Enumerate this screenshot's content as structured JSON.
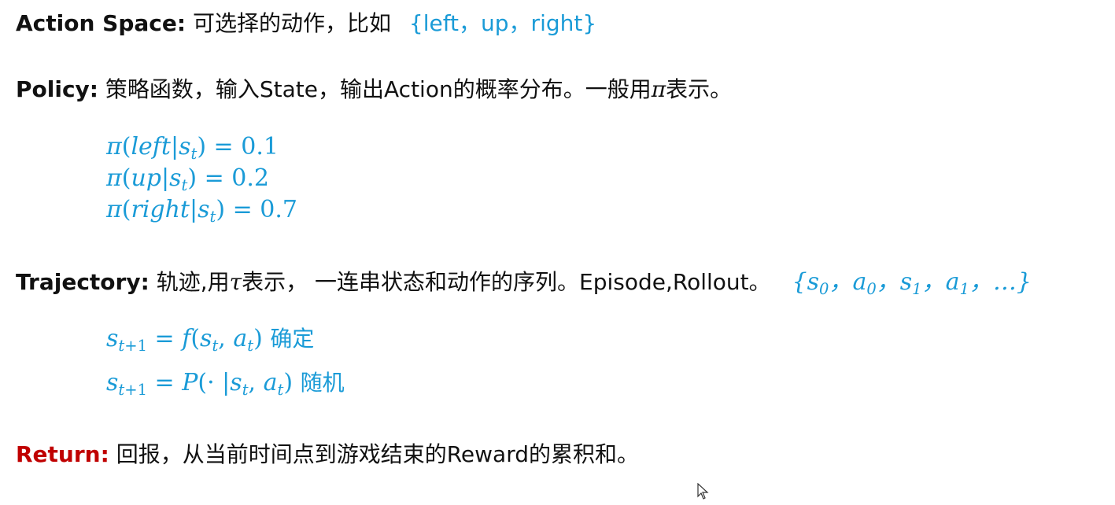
{
  "action_space": {
    "term": "Action Space:",
    "text": " 可选择的动作，比如 ",
    "example": "{left，up，right}"
  },
  "policy": {
    "term": "Policy:",
    "text_before": " 策略函数，输入State，输出Action的概率分布。一般用",
    "symbol": "π",
    "text_after": "表示。",
    "equations": [
      {
        "action": "left",
        "value": "0.1"
      },
      {
        "action": "up",
        "value": "0.2"
      },
      {
        "action": "right",
        "value": "0.7"
      }
    ]
  },
  "trajectory": {
    "term": "Trajectory:",
    "text_before": " 轨迹,用",
    "symbol": "τ",
    "text_after": "表示， 一连串状态和动作的序列。Episode,Rollout。",
    "sequence": "{s0，a0，s1，a1，…}",
    "transitions": [
      {
        "label": "确定"
      },
      {
        "label": "随机"
      }
    ]
  },
  "return": {
    "term": "Return:",
    "text": " 回报，从当前时间点到游戏结束的Reward的累积和。"
  },
  "colors": {
    "accent": "#1a9bd7",
    "return_term": "#c00000"
  }
}
